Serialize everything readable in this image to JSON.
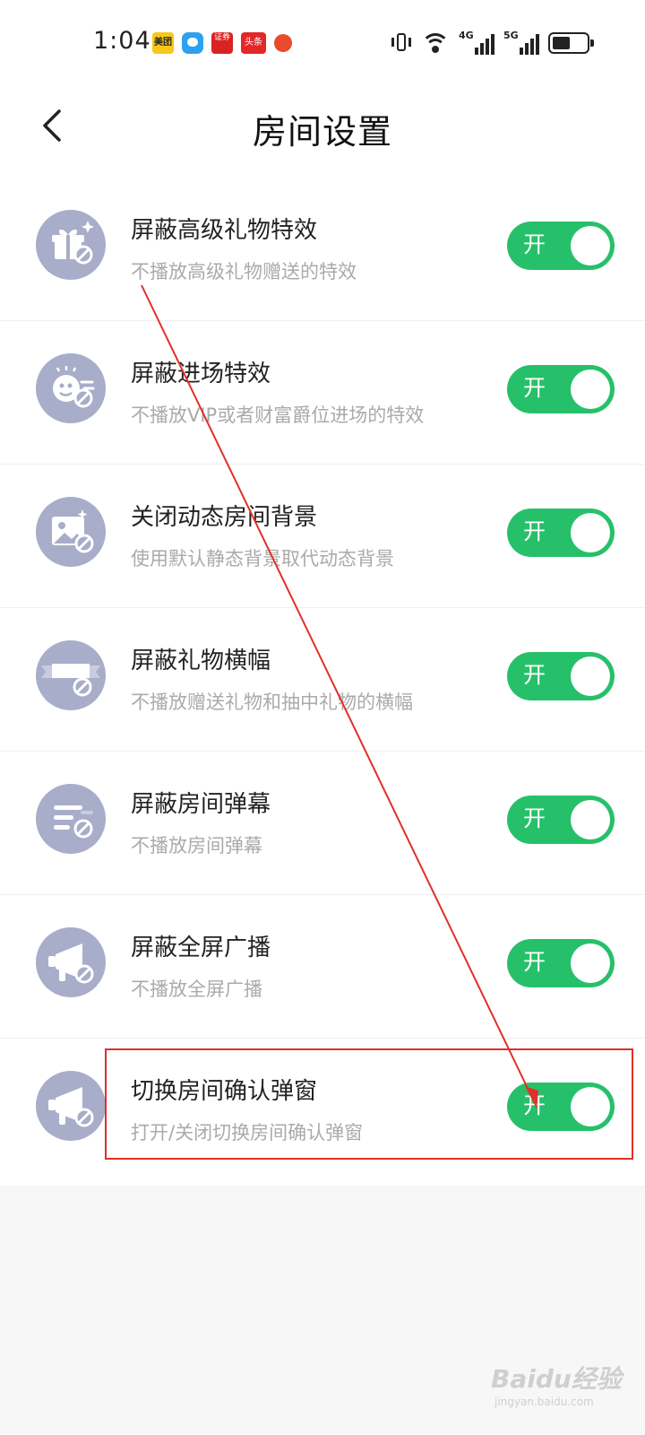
{
  "status_bar": {
    "time": "1:04",
    "app_icons": [
      "美团",
      "证券",
      "头条"
    ],
    "network_4g": "4G",
    "network_5g": "5G"
  },
  "header": {
    "title": "房间设置"
  },
  "settings": [
    {
      "title": "屏蔽高级礼物特效",
      "desc": "不播放高级礼物赠送的特效",
      "toggle_label": "开",
      "icon": "gift-block-icon",
      "on": true
    },
    {
      "title": "屏蔽进场特效",
      "desc": "不播放VIP或者财富爵位进场的特效",
      "toggle_label": "开",
      "icon": "entrance-block-icon",
      "on": true
    },
    {
      "title": "关闭动态房间背景",
      "desc": "使用默认静态背景取代动态背景",
      "toggle_label": "开",
      "icon": "image-block-icon",
      "on": true
    },
    {
      "title": "屏蔽礼物横幅",
      "desc": "不播放赠送礼物和抽中礼物的横幅",
      "toggle_label": "开",
      "icon": "banner-block-icon",
      "on": true
    },
    {
      "title": "屏蔽房间弹幕",
      "desc": "不播放房间弹幕",
      "toggle_label": "开",
      "icon": "danmaku-block-icon",
      "on": true
    },
    {
      "title": "屏蔽全屏广播",
      "desc": "不播放全屏广播",
      "toggle_label": "开",
      "icon": "megaphone-block-icon",
      "on": true
    },
    {
      "title": "切换房间确认弹窗",
      "desc": "打开/关闭切换房间确认弹窗",
      "toggle_label": "开",
      "icon": "megaphone-block-icon",
      "on": true
    }
  ],
  "colors": {
    "toggle_on": "#27c06a",
    "icon_bg": "#a8adc9",
    "annotation": "#e0302a"
  },
  "watermark": {
    "main": "Baidu经验",
    "sub": "jingyan.baidu.com"
  }
}
